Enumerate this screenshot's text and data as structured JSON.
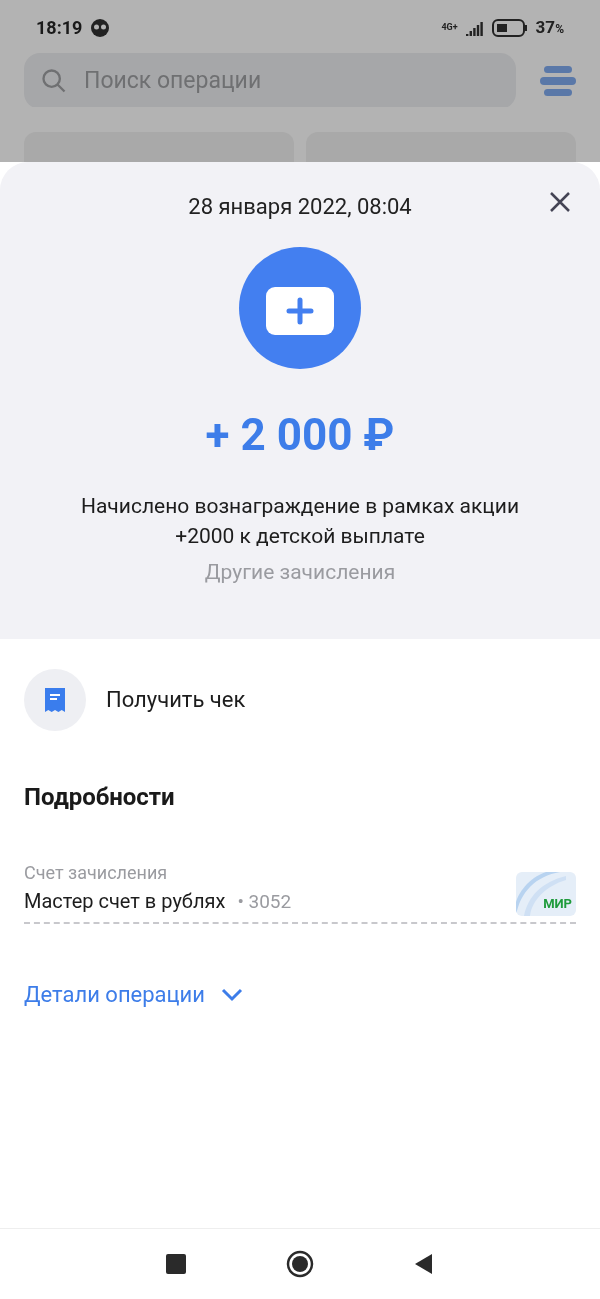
{
  "status_bar": {
    "time": "18:19",
    "network": "4G+",
    "battery": "37",
    "battery_unit": "%"
  },
  "background": {
    "search_placeholder": "Поиск операции",
    "cards": [
      {
        "kind": "card"
      },
      {
        "kind": "card"
      }
    ]
  },
  "sheet": {
    "date": "28 января 2022, 08:04",
    "amount": "+ 2 000 ₽",
    "description": "Начислено вознаграждение в рамках акции +2000 к детской выплате",
    "category": "Другие зачисления"
  },
  "receipt_action": "Получить чек",
  "details": {
    "title": "Подробности",
    "account_label": "Счет зачисления",
    "account_name": "Мастер счет в рублях",
    "account_number": "• 3052",
    "card_brand": "МИР"
  },
  "more_details": {
    "label": "Детали операции",
    "expanded": false
  }
}
